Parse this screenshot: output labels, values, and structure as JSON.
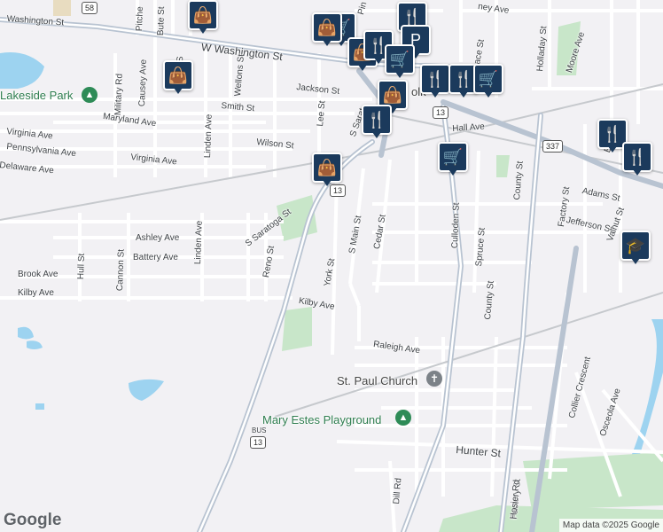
{
  "map": {
    "colors": {
      "road_major": "#a7b4c4",
      "road_minor": "#ffffff",
      "park": "#c8e6c9",
      "water": "#9dd3f0",
      "rail": "#b9bcc0",
      "bg": "#f2f1f4",
      "poi": "#1b3a5c"
    },
    "street_labels": [
      {
        "id": "w-washington-st-1",
        "text": "Washington St"
      },
      {
        "id": "w-washington-st-2",
        "text": "W Washington St"
      },
      {
        "id": "jackson-st",
        "text": "Jackson St"
      },
      {
        "id": "smith-st",
        "text": "Smith St"
      },
      {
        "id": "maryland-ave",
        "text": "Maryland Ave"
      },
      {
        "id": "virginia-ave-1",
        "text": "Virginia Ave"
      },
      {
        "id": "virginia-ave-2",
        "text": "Virginia Ave"
      },
      {
        "id": "pennsylvania-ave",
        "text": "Pennsylvania Ave"
      },
      {
        "id": "delaware-ave",
        "text": "Delaware Ave"
      },
      {
        "id": "wilson-st",
        "text": "Wilson St"
      },
      {
        "id": "military-rd",
        "text": "Military Rd"
      },
      {
        "id": "causey-ave",
        "text": "Causey Ave"
      },
      {
        "id": "pitchett",
        "text": "Pitche"
      },
      {
        "id": "bute-st",
        "text": "Bute St"
      },
      {
        "id": "linden-ave-1",
        "text": "Linden Ave"
      },
      {
        "id": "linden-ave-2",
        "text": "Linden Ave"
      },
      {
        "id": "wellons-st",
        "text": "Wellons St"
      },
      {
        "id": "lee-st",
        "text": "Lee St"
      },
      {
        "id": "s-saratoga-st-1",
        "text": "S Sarat"
      },
      {
        "id": "s-saratoga-st-2",
        "text": "S Saratoga St"
      },
      {
        "id": "ashley-ave",
        "text": "Ashley Ave"
      },
      {
        "id": "battery-ave",
        "text": "Battery Ave"
      },
      {
        "id": "brook-ave",
        "text": "Brook Ave"
      },
      {
        "id": "kilby-ave-1",
        "text": "Kilby Ave"
      },
      {
        "id": "kilby-ave-2",
        "text": "Kilby Ave"
      },
      {
        "id": "hull-st",
        "text": "Hull St"
      },
      {
        "id": "cannon-st",
        "text": "Cannon St"
      },
      {
        "id": "reno-st",
        "text": "Reno St"
      },
      {
        "id": "york-st",
        "text": "York St"
      },
      {
        "id": "s-main-st",
        "text": "S Main St"
      },
      {
        "id": "cedar-st",
        "text": "Cedar St"
      },
      {
        "id": "hall-ave",
        "text": "Hall Ave"
      },
      {
        "id": "culloden-st",
        "text": "Culloden St"
      },
      {
        "id": "spruce-st",
        "text": "Spruce St"
      },
      {
        "id": "county-st-1",
        "text": "County St"
      },
      {
        "id": "county-st-2",
        "text": "County St"
      },
      {
        "id": "factory-st-1",
        "text": "Factory St"
      },
      {
        "id": "factory-st-2",
        "text": "Factory St"
      },
      {
        "id": "adams-st",
        "text": "Adams St"
      },
      {
        "id": "jefferson-st",
        "text": "Jefferson St"
      },
      {
        "id": "walnut-st",
        "text": "Valnut St"
      },
      {
        "id": "raleigh-ave",
        "text": "Raleigh Ave"
      },
      {
        "id": "hunter-st",
        "text": "Hunter St"
      },
      {
        "id": "dill-rd",
        "text": "Dill Rd"
      },
      {
        "id": "hosier-rd",
        "text": "Hosier Rd"
      },
      {
        "id": "collier-crescent",
        "text": "Collier Crescent"
      },
      {
        "id": "osceola-ave",
        "text": "Osceola Ave"
      },
      {
        "id": "holladay-st",
        "text": "Holladay St"
      },
      {
        "id": "moore-ave",
        "text": "Moore Ave"
      },
      {
        "id": "terrace-st",
        "text": "rrace St"
      },
      {
        "id": "ney-ave",
        "text": "ney Ave"
      },
      {
        "id": "pine",
        "text": "Pin"
      },
      {
        "id": "bsh",
        "text": "B"
      },
      {
        "id": "sh",
        "text": "S"
      }
    ],
    "places": {
      "lakeside_park": "Lakeside Park",
      "st_paul_church": "St. Paul Church",
      "mary_estes_playground": "Mary Estes Playground",
      "downtown": "olk"
    },
    "shields": {
      "us58": "58",
      "rt13_a": "13",
      "rt13_b": "13",
      "rt337": "337",
      "bus13": "13",
      "bus_label": "BUS"
    },
    "poi_icons": {
      "shopping": "shopping-bag-icon",
      "restaurant": "restaurant-icon",
      "grocery": "shopping-cart-icon",
      "school": "school-icon",
      "parking": "parking-icon"
    },
    "attribution": "Map data ©2025 Google",
    "logo": "Google"
  }
}
